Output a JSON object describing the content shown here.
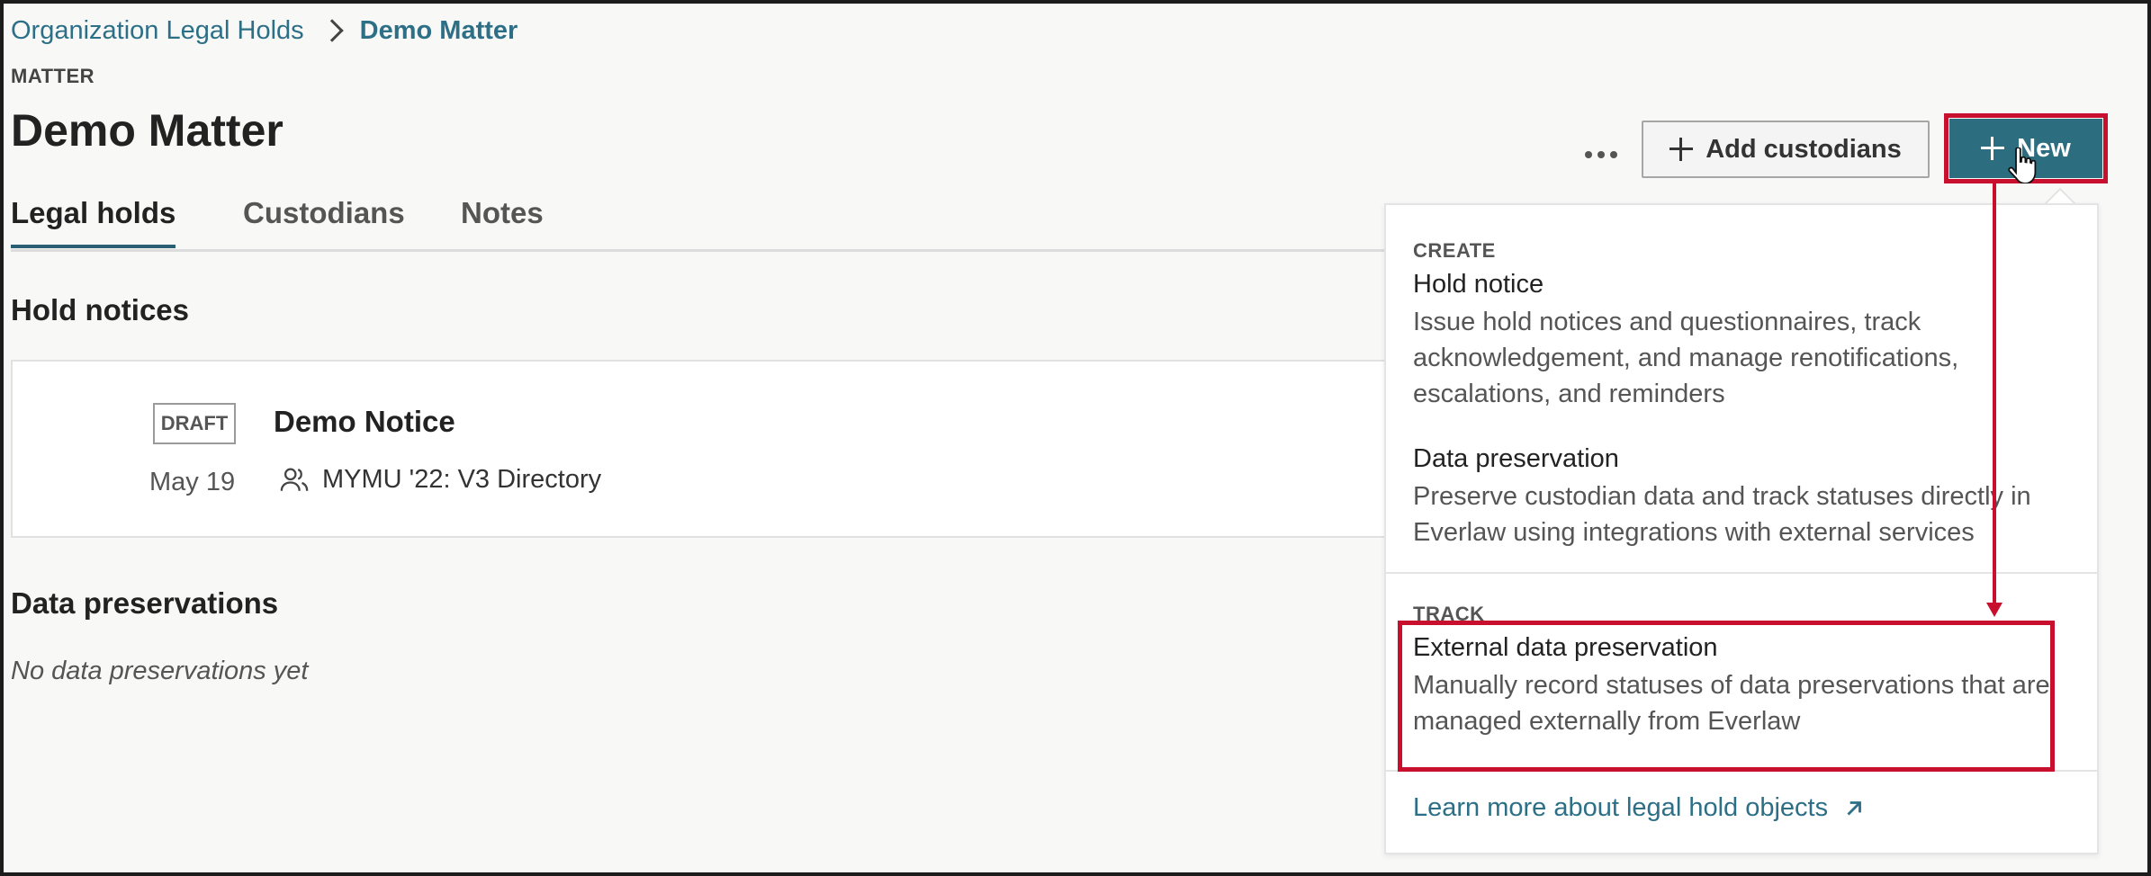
{
  "breadcrumb": {
    "parent": "Organization Legal Holds",
    "current": "Demo Matter"
  },
  "header": {
    "eyebrow": "MATTER",
    "title": "Demo Matter",
    "add_button_label": "Add custodians",
    "new_button_label": "New"
  },
  "tabs": [
    {
      "label": "Legal holds",
      "active": true
    },
    {
      "label": "Custodians",
      "active": false
    },
    {
      "label": "Notes",
      "active": false
    }
  ],
  "hold_notices": {
    "heading": "Hold notices",
    "items": [
      {
        "status": "DRAFT",
        "title": "Demo Notice",
        "date": "May 19",
        "directory": "MYMU '22: V3 Directory"
      }
    ]
  },
  "data_preservations": {
    "heading": "Data preservations",
    "empty_text": "No data preservations yet"
  },
  "dropdown": {
    "create_heading": "CREATE",
    "items_create": [
      {
        "title": "Hold notice",
        "description": "Issue hold notices and questionnaires, track acknowledgement, and manage renotifications, escalations, and reminders"
      },
      {
        "title": "Data preservation",
        "description": "Preserve custodian data and track statuses directly in Everlaw using integrations with external services"
      }
    ],
    "track_heading": "TRACK",
    "items_track": [
      {
        "title": "External data preservation",
        "description": "Manually record statuses of data preservations that are managed externally from Everlaw"
      }
    ],
    "learn_more": "Learn more about legal hold objects"
  },
  "colors": {
    "accent": "#2c6d7f",
    "link": "#2d6f86",
    "annotation": "#c8102e"
  }
}
